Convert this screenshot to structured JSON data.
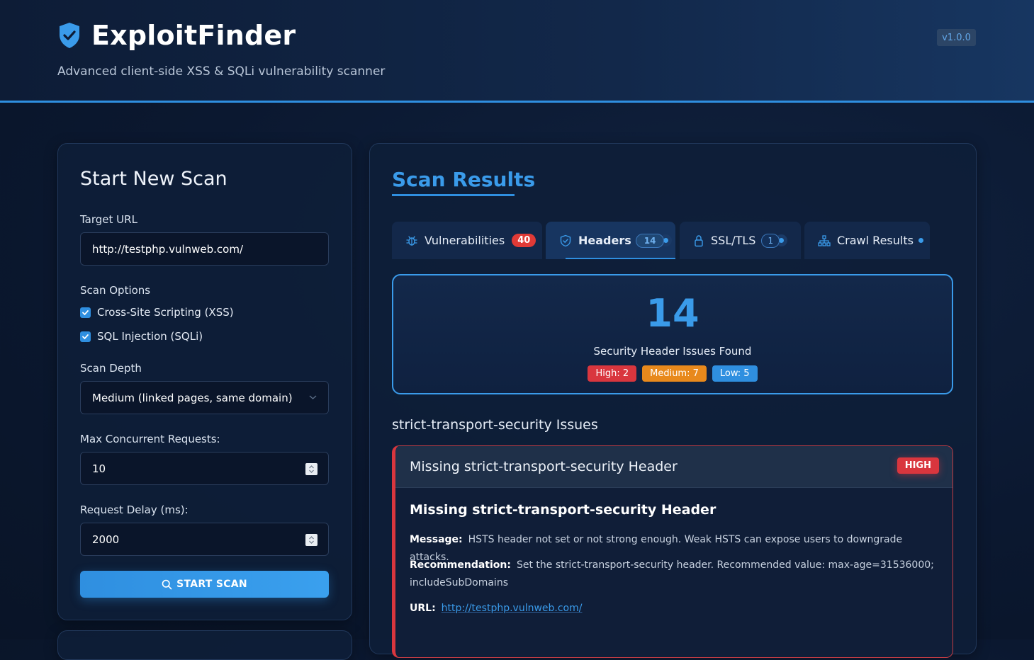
{
  "app": {
    "title": "ExploitFinder",
    "tagline": "Advanced client-side XSS & SQLi vulnerability scanner",
    "version": "v1.0.0"
  },
  "scan_form": {
    "title": "Start New Scan",
    "target_url_label": "Target URL",
    "target_url_value": "http://testphp.vulnweb.com/",
    "scan_options_label": "Scan Options",
    "options": [
      {
        "label": "Cross-Site Scripting (XSS)",
        "checked": true
      },
      {
        "label": "SQL Injection (SQLi)",
        "checked": true
      }
    ],
    "depth_label": "Scan Depth",
    "depth_value": "Medium (linked pages, same domain)",
    "concurrent_label": "Max Concurrent Requests:",
    "concurrent_value": "10",
    "delay_label": "Request Delay (ms):",
    "delay_value": "2000",
    "start_button": "START SCAN"
  },
  "results": {
    "title": "Scan Results",
    "tabs": [
      {
        "label": "Vulnerabilities",
        "count": "40",
        "icon": "bug-icon"
      },
      {
        "label": "Headers",
        "count": "14",
        "icon": "shield-icon",
        "active": true
      },
      {
        "label": "SSL/TLS",
        "count": "1",
        "icon": "lock-icon"
      },
      {
        "label": "Crawl Results",
        "icon": "sitemap-icon"
      }
    ],
    "summary": {
      "count": "14",
      "label": "Security Header Issues Found",
      "high": "High: 2",
      "medium": "Medium: 7",
      "low": "Low: 5"
    },
    "section_title": "strict-transport-security Issues",
    "issue": {
      "header_title": "Missing strict-transport-security Header",
      "severity": "HIGH",
      "title": "Missing strict-transport-security Header",
      "message_label": "Message:",
      "message": "HSTS header not set or not strong enough. Weak HSTS can expose users to downgrade attacks.",
      "recommendation_label": "Recommendation:",
      "recommendation": "Set the strict-transport-security header. Recommended value: max-age=31536000; includeSubDomains",
      "url_label": "URL:",
      "url": "http://testphp.vulnweb.com/"
    }
  },
  "colors": {
    "accent": "#2f8fe0",
    "high": "#d9363e",
    "medium": "#e8891c",
    "low": "#2f8fe0"
  }
}
